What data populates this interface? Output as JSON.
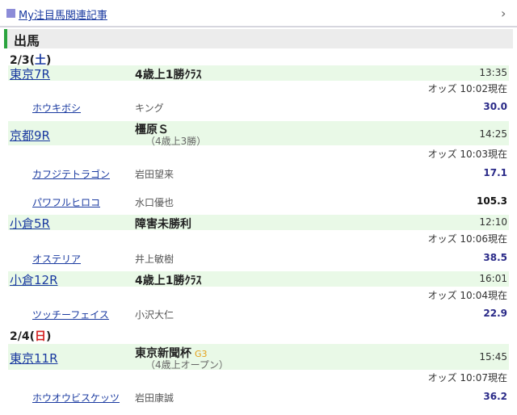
{
  "header": {
    "title": "My注目馬関連記事",
    "chevron": "›"
  },
  "section": {
    "title": "出馬"
  },
  "dates": [
    {
      "label": "2/3(",
      "day": "土",
      "close": ")"
    },
    {
      "label": "2/4(",
      "day": "日",
      "close": ")"
    }
  ],
  "races": [
    {
      "name": "東京7R",
      "title": "4歳上1勝ｸﾗｽ",
      "sub": "",
      "time": "13:35",
      "odds_time": "オッズ 10:02現在",
      "entries": [
        {
          "horse": "ホウキボシ",
          "jockey": "キング",
          "odds": "30.0"
        }
      ]
    },
    {
      "name": "京都9R",
      "title": "橿原Ｓ",
      "sub": "（4歳上3勝）",
      "time": "14:25",
      "odds_time": "オッズ 10:03現在",
      "entries": [
        {
          "horse": "カフジテトラゴン",
          "jockey": "岩田望来",
          "odds": "17.1"
        },
        {
          "horse": "パワフルヒロコ",
          "jockey": "水口優也",
          "odds": "105.3"
        }
      ]
    },
    {
      "name": "小倉5R",
      "title": "障害未勝利",
      "sub": "",
      "time": "12:10",
      "odds_time": "オッズ 10:06現在",
      "entries": [
        {
          "horse": "オステリア",
          "jockey": "井上敏樹",
          "odds": "38.5"
        }
      ]
    },
    {
      "name": "小倉12R",
      "title": "4歳上1勝ｸﾗｽ",
      "sub": "",
      "time": "16:01",
      "odds_time": "オッズ 10:04現在",
      "entries": [
        {
          "horse": "ツッチーフェイス",
          "jockey": "小沢大仁",
          "odds": "22.9"
        }
      ]
    },
    {
      "name": "東京11R",
      "title": "東京新聞杯",
      "grade": "G3",
      "sub": "（4歳上オープン）",
      "time": "15:45",
      "odds_time": "オッズ 10:07現在",
      "entries": [
        {
          "horse": "ホウオウビスケッツ",
          "jockey": "岩田康誠",
          "odds": "36.2"
        }
      ]
    }
  ],
  "colors": {
    "accent": "#1a3aa0",
    "race_bg": "#e9f9e7",
    "section_bar": "#2aa33e",
    "sunday": "#d42020",
    "grade": "#e5a01a"
  }
}
